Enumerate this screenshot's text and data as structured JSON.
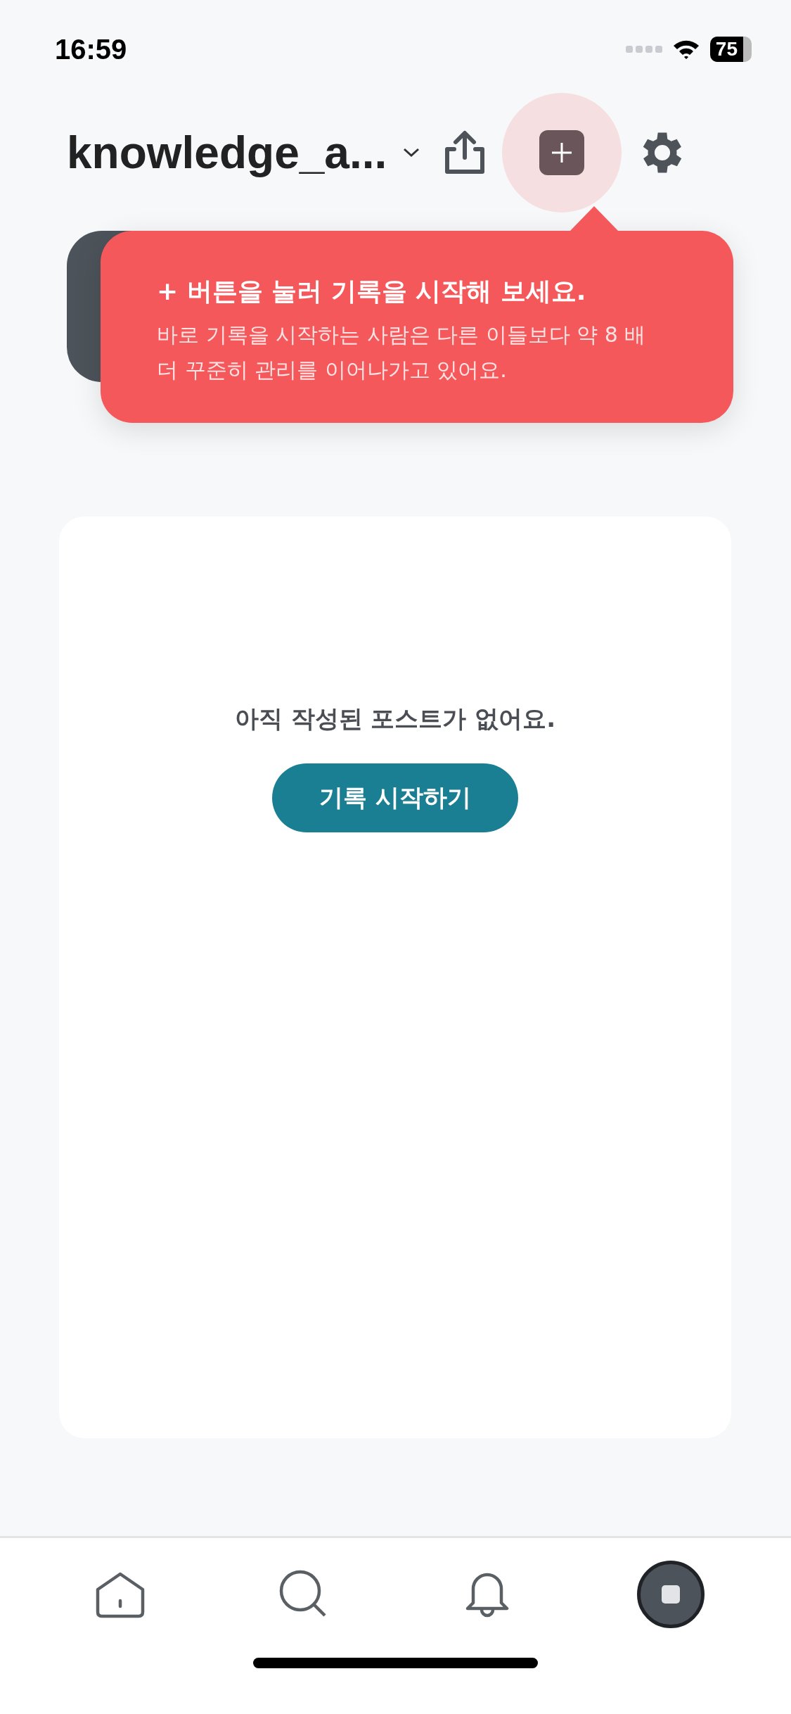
{
  "status_bar": {
    "time": "16:59",
    "battery": "75"
  },
  "header": {
    "title": "knowledge_a..."
  },
  "tooltip": {
    "title": "+ 버튼을 눌러 기록을 시작해 보세요.",
    "body": "바로 기록을 시작하는 사람은 다른 이들보다 약 8 배 더 꾸준히 관리를 이어나가고 있어요."
  },
  "empty_state": {
    "message": "아직 작성된 포스트가 없어요.",
    "button": "기록 시작하기"
  },
  "tab_bar": [
    {
      "kind": "home",
      "selected": false
    },
    {
      "kind": "search",
      "selected": false
    },
    {
      "kind": "bell",
      "selected": false
    },
    {
      "kind": "profile",
      "selected": true
    }
  ]
}
